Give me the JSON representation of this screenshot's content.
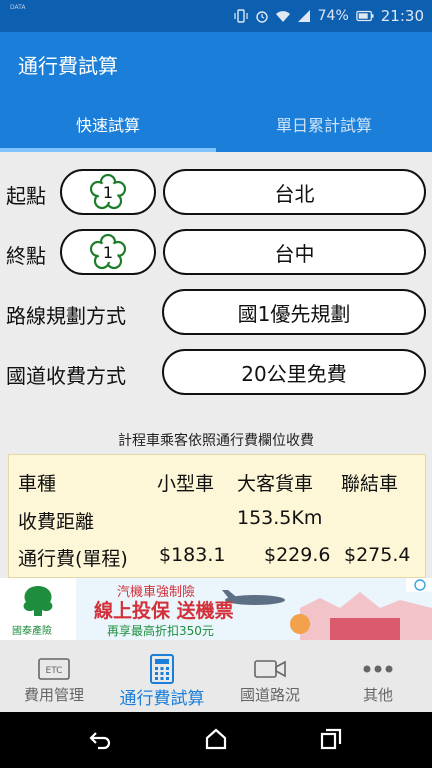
{
  "status": {
    "carrier": "DATA",
    "battery": "74%",
    "time": "21:30"
  },
  "app": {
    "title": "通行費試算"
  },
  "tabs": [
    {
      "label": "快速試算"
    },
    {
      "label": "單日累計試算"
    }
  ],
  "form": {
    "start": {
      "label": "起點",
      "highway": "1",
      "value": "台北"
    },
    "end": {
      "label": "終點",
      "highway": "1",
      "value": "台中"
    },
    "route": {
      "label": "路線規劃方式",
      "value": "國1優先規劃"
    },
    "fee_mode": {
      "label": "國道收費方式",
      "value": "20公里免費"
    }
  },
  "note": "計程車乘客依照通行費欄位收費",
  "fees": {
    "header": {
      "label": "車種",
      "small": "小型車",
      "large": "大客貨車",
      "trailer": "聯結車"
    },
    "distance": {
      "label": "收費距離",
      "value": "153.5Km"
    },
    "toll": {
      "label": "通行費(單程)",
      "small": "$183.1",
      "large": "$229.6",
      "trailer": "$275.4"
    }
  },
  "ad": {
    "brand": "國泰產險",
    "line1": "汽機車強制險",
    "line2": "線上投保 送機票",
    "line3": "再享最高折扣350元"
  },
  "nav": [
    {
      "label": "費用管理",
      "icon": "etc-icon"
    },
    {
      "label": "通行費試算",
      "icon": "calculator-icon"
    },
    {
      "label": "國道路況",
      "icon": "camera-icon"
    },
    {
      "label": "其他",
      "icon": "more-icon"
    }
  ],
  "colors": {
    "primary": "#1b7fd9",
    "statusbar": "#0d5fb0",
    "fee_bg": "#fef7d7",
    "highway_green": "#1d7d2a"
  }
}
